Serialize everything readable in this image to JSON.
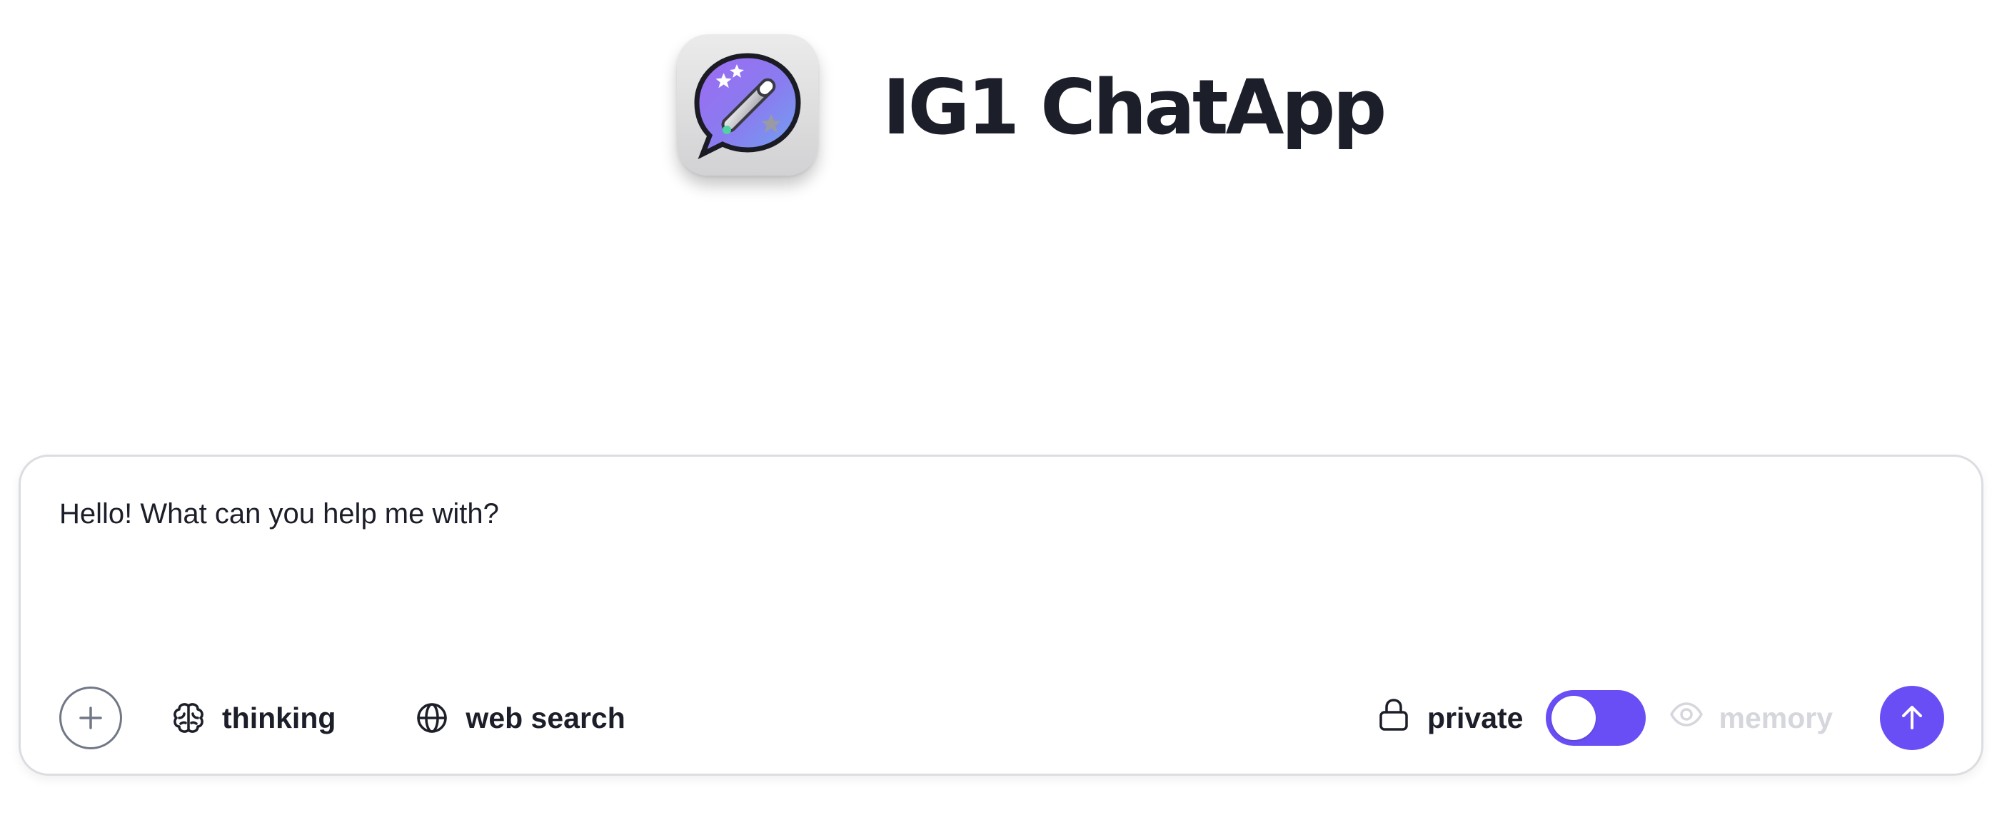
{
  "header": {
    "app_title": "IG1 ChatApp",
    "logo_icon": "magic-wand-chat-bubble-icon"
  },
  "composer": {
    "input_value": "Hello! What can you help me with?",
    "add_icon": "plus-icon",
    "tools": {
      "thinking": {
        "label": "thinking",
        "icon": "brain-icon"
      },
      "web_search": {
        "label": "web search",
        "icon": "globe-icon"
      }
    },
    "private": {
      "label": "private",
      "icon": "lock-icon",
      "toggle_on": true
    },
    "memory": {
      "label": "memory",
      "icon": "eye-icon",
      "enabled": false
    },
    "send_icon": "arrow-up-icon"
  },
  "colors": {
    "accent": "#6a4ef5",
    "text": "#1c1e29",
    "disabled_text": "#d6d7dd",
    "border": "#dcdde2"
  }
}
